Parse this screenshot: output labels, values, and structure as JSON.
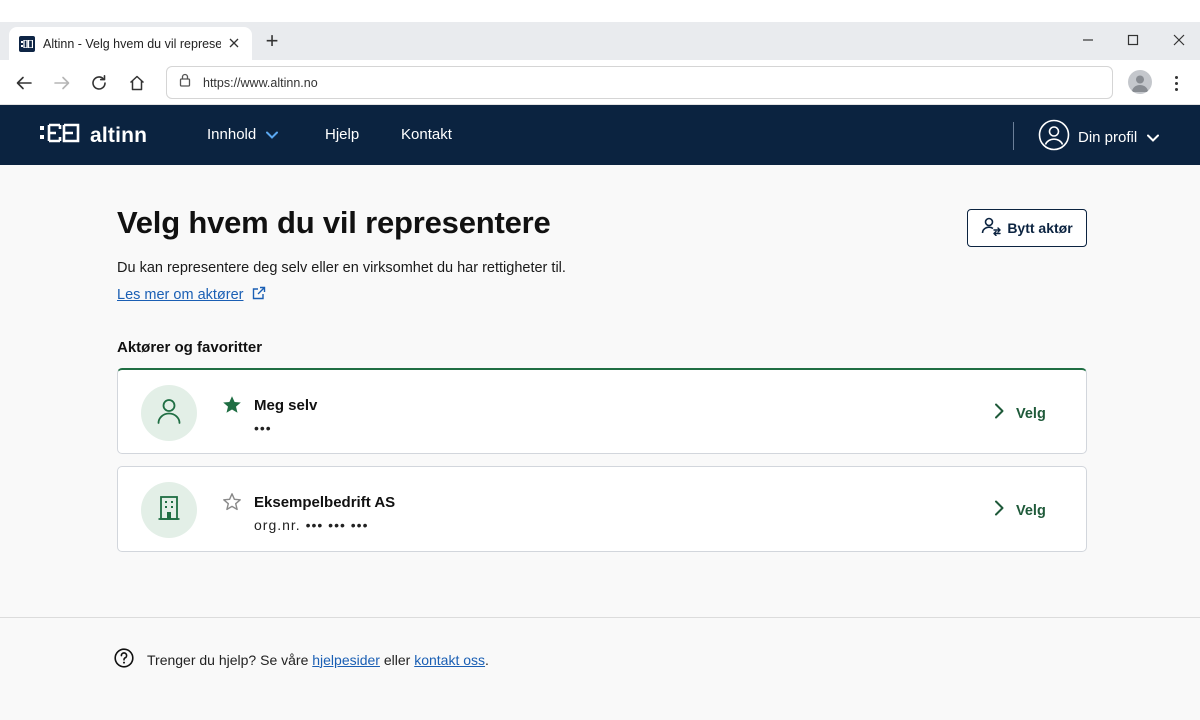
{
  "browser": {
    "tab_title": "Altinn - Velg hvem du vil representere",
    "new_tab_symbol": "+",
    "url": "https://www.altinn.no"
  },
  "header": {
    "logo_text": "altinn",
    "nav": {
      "innhold": "Innhold",
      "hjelp": "Hjelp",
      "kontakt": "Kontakt"
    },
    "profile_label": "Din profil"
  },
  "main": {
    "title": "Velg hvem du vil representere",
    "switch_button": "Bytt aktør",
    "intro": "Du kan representere deg selv eller en virksomhet du har rettigheter til.",
    "learn_more": "Les mer om aktører",
    "section_heading": "Aktører og favoritter",
    "actors": [
      {
        "name": "Meg selv",
        "sub": "•••",
        "favorite": true,
        "type": "person",
        "select_label": "Velg"
      },
      {
        "name": "Eksempelbedrift AS",
        "sub": "org.nr. ••• ••• •••",
        "favorite": false,
        "type": "organization",
        "select_label": "Velg"
      }
    ]
  },
  "footer": {
    "prefix": "Trenger du hjelp? Se våre",
    "help_link": "hjelpesider",
    "middle": "eller",
    "contact_link": "kontakt oss",
    "suffix": "."
  },
  "colors": {
    "header_bg": "#0b2340",
    "accent_green": "#1f6e43",
    "link_blue": "#1a5fb4"
  }
}
